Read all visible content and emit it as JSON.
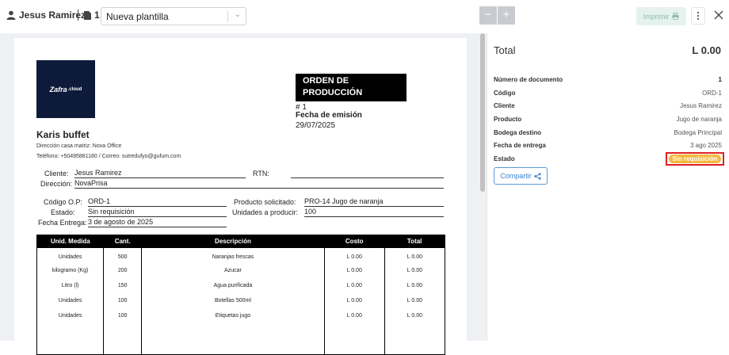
{
  "header": {
    "user_name": "Jesus Ramirez",
    "doc_count": "1",
    "template_value": "Nueva plantilla",
    "zoom_out": "−",
    "zoom_in": "+",
    "print_label": "Imprimir"
  },
  "document": {
    "logo_text": "Zafra",
    "logo_suffix": ".cloud",
    "order_title_line1": "ORDEN DE",
    "order_title_line2": "PRODUCCIÓN",
    "order_number": "# 1",
    "emission_label": "Fecha de emisión",
    "emission_date": "29/07/2025",
    "company_name": "Karis  buffet",
    "address": "Dirección casa matriz: Nova Office",
    "contact": "Teléfono: +50495881180 / Correo: sutredufyo@gufum.com",
    "client_label": "Cliente:",
    "client_value": "Jesus Ramirez",
    "rtn_label": "RTN:",
    "rtn_value": "",
    "direccion_label": "Dirección:",
    "direccion_value": "NovaPrisa",
    "codigo_label": "Código O.P:",
    "codigo_value": "ORD-1",
    "estado_label": "Estado:",
    "estado_value": "Sin requisición",
    "entrega_label": "Fecha Entrega:",
    "entrega_value": "3 de agosto de 2025",
    "producto_label": "Producto solicitado:",
    "producto_value": "PRO-14 Jugo de naranja",
    "unidades_label": "Unidades a producir:",
    "unidades_value": "100",
    "table": {
      "headers": [
        "Unid. Medida",
        "Cant.",
        "Descripción",
        "Costo",
        "Total"
      ],
      "rows": [
        [
          "Unidades",
          "500",
          "Naranjas frescas",
          "L 0.00",
          "L 0.00"
        ],
        [
          "kilogramo (Kg)",
          "200",
          "Azucar",
          "L 0.00",
          "L 0.00"
        ],
        [
          "Litro (l)",
          "150",
          "Agua purificada",
          "L 0.00",
          "L 0.00"
        ],
        [
          "Unidades",
          "100",
          "Botellas 500ml",
          "L 0.00",
          "L 0.00"
        ],
        [
          "Unidades",
          "100",
          "Etiquetas jugo",
          "L 0.00",
          "L 0.00"
        ]
      ]
    }
  },
  "panel": {
    "total_label": "Total",
    "total_value": "L 0.00",
    "fields": [
      {
        "label": "Número de documento",
        "value": "1"
      },
      {
        "label": "Código",
        "value": "ORD-1"
      },
      {
        "label": "Cliente",
        "value": "Jesus Ramirez"
      },
      {
        "label": "Producto",
        "value": "Jugo de naranja"
      },
      {
        "label": "Bodega destino",
        "value": "Bodega Principal"
      },
      {
        "label": "Fecha de entrega",
        "value": "3 ago 2025"
      }
    ],
    "estado_label": "Estado",
    "estado_badge": "Sin requisición",
    "share_label": "Compartir"
  },
  "colors": {
    "badge": "#f5b83d",
    "badge_highlight": "#e02020",
    "share": "#3a86cf",
    "logo_bg": "#0d1a3a"
  }
}
